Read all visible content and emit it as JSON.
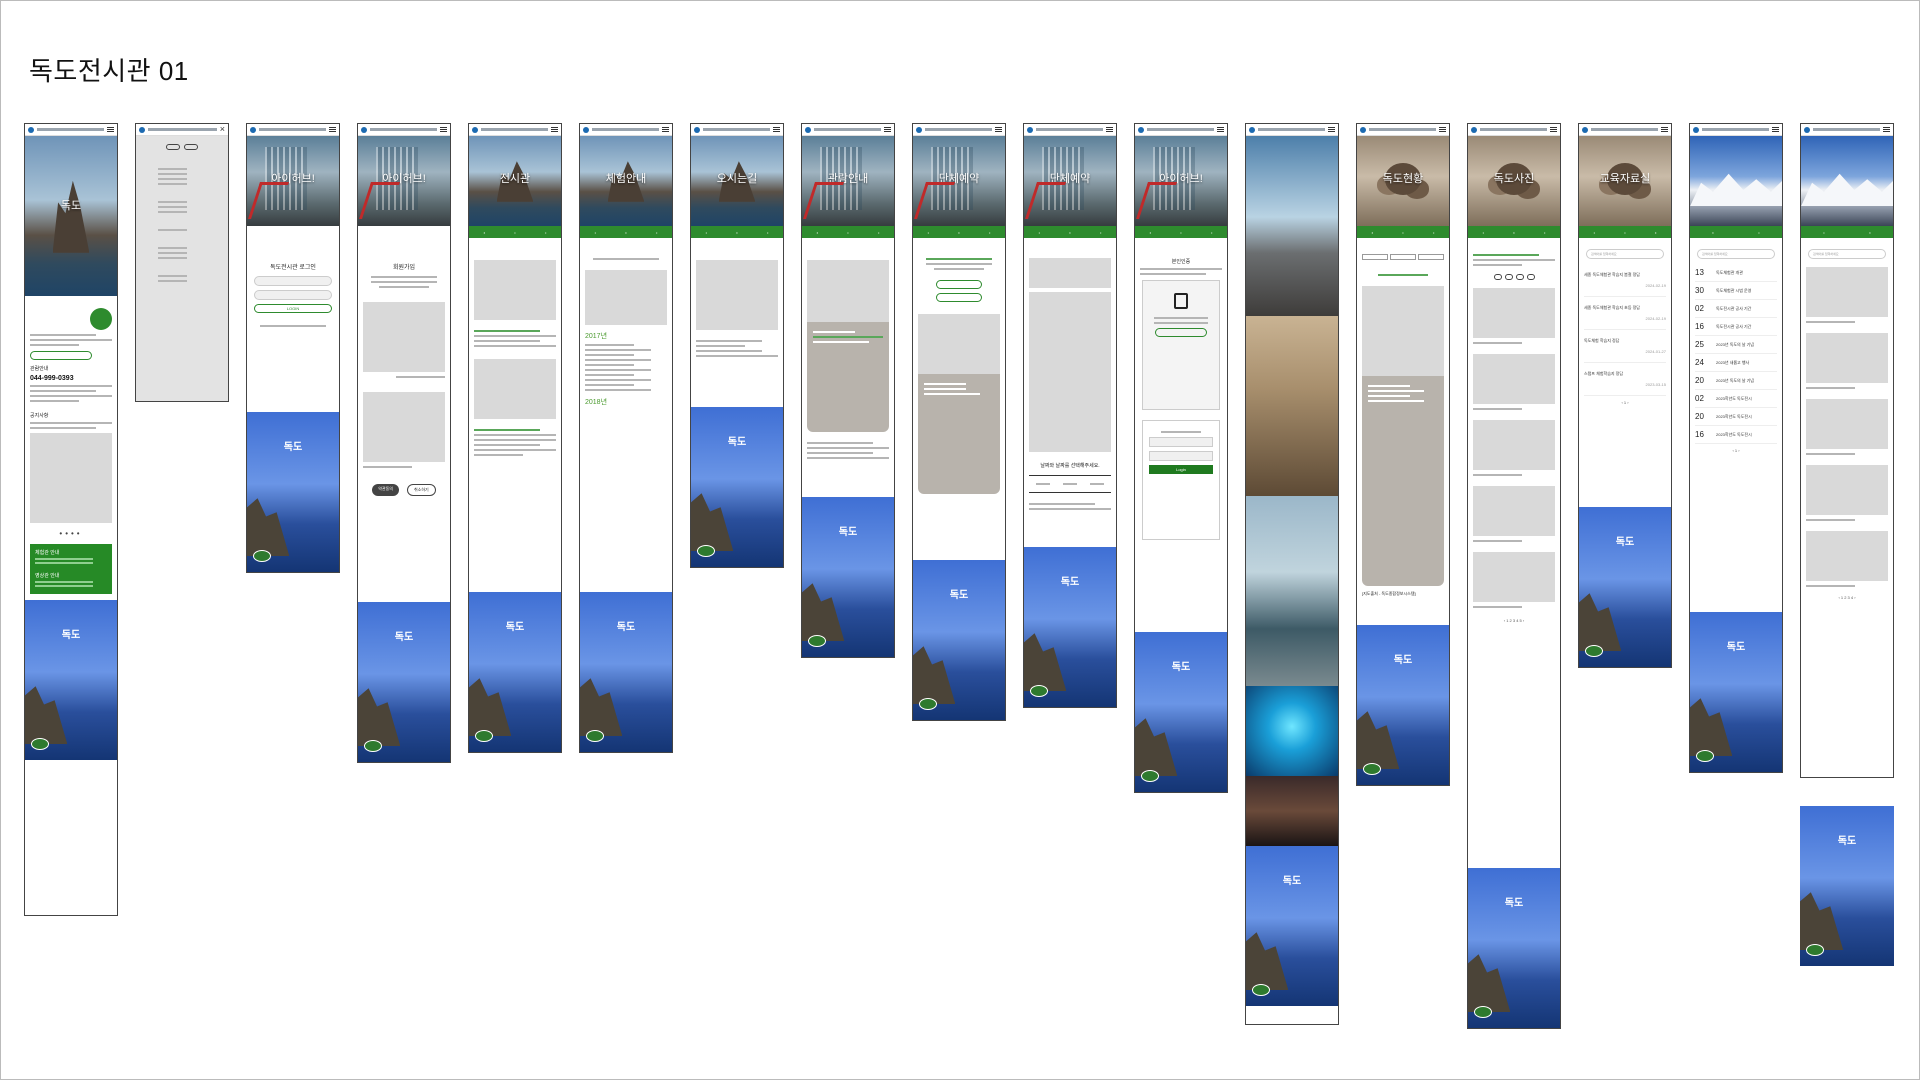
{
  "board": {
    "title": "독도전시관 01"
  },
  "login": {
    "title": "독도전시관 로그인",
    "button": "LOGIN",
    "submit": "Login"
  },
  "signup": {
    "title": "회원가입",
    "agree": "약관동의",
    "cancel": "취소하기"
  },
  "footer": {
    "title": "독도"
  },
  "hero_labels": {
    "intro": "독도",
    "about": "아이허브!",
    "exhibit": "전시관",
    "program": "체험안내",
    "route": "오시는길",
    "info": "관람안내",
    "group": "단체예약",
    "group2": "단체예약",
    "member": "아이허브!",
    "news": "독도현황",
    "gallery": "독도사진",
    "edu": "교육자료실"
  },
  "home": {
    "guide": "관람안내",
    "phone": "044-999-0393",
    "notice": "공지사항",
    "exhibit_info": "체험관 안내",
    "edu_info": "영상관 안내"
  },
  "timeline": {
    "year1": "2017년",
    "year2": "2018년"
  },
  "date_select": {
    "title": "날짜와 날짜를 선택해주세요."
  },
  "cert": {
    "title": "본인인증"
  },
  "location": {
    "caption": "[지도출처 - 독도종합정보시스템]"
  },
  "event_list": {
    "items": [
      {
        "day": "13",
        "text": "독도체험관 개관"
      },
      {
        "day": "30",
        "text": "독도체험관 시범 운영"
      },
      {
        "day": "02",
        "text": "독도전시관 공사 기간"
      },
      {
        "day": "16",
        "text": "독도전시관 공사 기간"
      },
      {
        "day": "25",
        "text": "2023년 독도의 날 기념"
      },
      {
        "day": "24",
        "text": "2023년 새롭고 행사"
      },
      {
        "day": "20",
        "text": "2023년 독도의 날 기념"
      },
      {
        "day": "02",
        "text": "2023학년도 독도전시"
      },
      {
        "day": "20",
        "text": "2023학년도 독도전시"
      },
      {
        "day": "16",
        "text": "2023학년도 독도전시"
      }
    ]
  },
  "edu_list": {
    "items": [
      {
        "title": "세종 독도체험관 학습지 봄철 정답",
        "date": "2024-02-19"
      },
      {
        "title": "세종 독도체험관 학습지 초등 정답",
        "date": "2024-02-19"
      },
      {
        "title": "독도체험 학습지 정답",
        "date": "2024-01-27"
      },
      {
        "title": "스탬프 체험학습지 정답",
        "date": "2023-03-15"
      }
    ]
  },
  "search": {
    "placeholder": "검색어를 입력하세요"
  }
}
